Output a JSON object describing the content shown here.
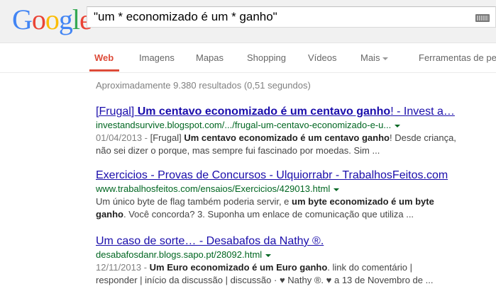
{
  "logo": {
    "letters": [
      "G",
      "o",
      "o",
      "g",
      "l",
      "e"
    ]
  },
  "search": {
    "query": "\"um * economizado é um * ganho\"",
    "keyboard_icon": "keyboard-icon"
  },
  "tabs": [
    {
      "label": "Web",
      "active": true
    },
    {
      "label": "Imagens"
    },
    {
      "label": "Mapas"
    },
    {
      "label": "Shopping"
    },
    {
      "label": "Vídeos"
    },
    {
      "label": "Mais"
    },
    {
      "label": "Ferramentas de pesq"
    }
  ],
  "stats": "Aproximadamente 9.380 resultados (0,51 segundos)",
  "results": [
    {
      "title_a": "[Frugal] ",
      "title_b": "Um centavo economizado é um centavo ganho",
      "title_c": "! - Invest a…",
      "url": "investandsurvive.blogspot.com/.../frugal-um-centavo-economizado-e-u...",
      "date": "01/04/2013 - ",
      "s1a": "[Frugal] ",
      "s1b": "Um centavo economizado é um centavo ganho",
      "s1c": "! Desde criança,",
      "s2": "não sei dizer o porque, mas sempre fui fascinado por moedas. Sim ..."
    },
    {
      "title": "Exercicios - Provas de Concursos - Ulquiorrabr - TrabalhosFeitos.com",
      "url": "www.trabalhosfeitos.com/ensaios/Exercicios/429013.html",
      "s1a": "Um único byte de flag também poderia servir, e ",
      "s1b": "um byte economizado é um byte",
      "s2a": "ganho",
      "s2b": ". Você concorda? 3. Suponha um enlace de comunicação que utiliza ..."
    },
    {
      "title": "Um caso de sorte… - Desabafos da Nathy ®.",
      "url": "desabafosdanr.blogs.sapo.pt/28092.html",
      "date": "12/11/2013 - ",
      "s1b": "Um Euro economizado é um Euro ganho",
      "s1c": ". link do comentário |",
      "s2": "responder | início da discussão | discussão · ♥ Nathy ®. ♥ a 13 de Novembro de ..."
    }
  ],
  "colors": {
    "accent": "#dd4b39",
    "link": "#1a0dab",
    "url": "#006621"
  }
}
